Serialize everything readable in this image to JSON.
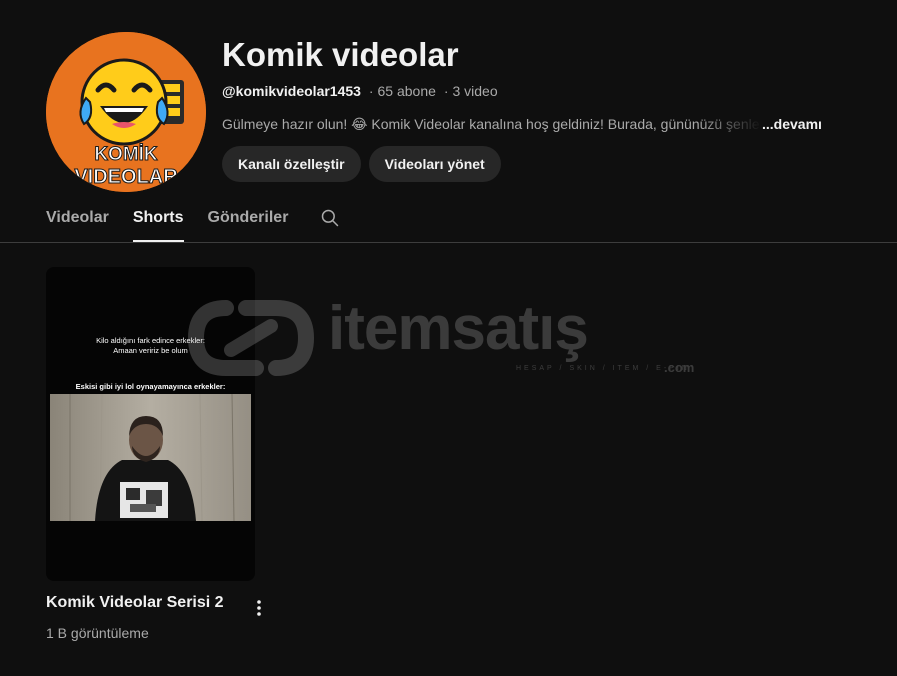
{
  "channel": {
    "name": "Komik videolar",
    "handle": "@komikvideolar1453",
    "subscribers": "65 abone",
    "video_count": "3 video",
    "separator": "·",
    "description": "Gülmeye hazır olun! 😂 Komik Videolar kanalına hoş geldiniz! Burada, gününüzü şenlendirecek",
    "more_label": "...devamı",
    "avatar": {
      "line1": "KOMİK",
      "line2": "VIDEOLAR",
      "bg_color": "#e8731f",
      "emoji_color": "#ffcc1a"
    }
  },
  "buttons": {
    "customize": "Kanalı özelleştir",
    "manage": "Videoları yönet"
  },
  "tabs": [
    {
      "label": "Videolar",
      "active": false
    },
    {
      "label": "Shorts",
      "active": true
    },
    {
      "label": "Gönderiler",
      "active": false
    }
  ],
  "search_icon": "search-icon",
  "shorts": [
    {
      "title": "Komik Videolar Serisi 2",
      "views": "1 B görüntüleme",
      "caption_line1": "Kilo aldığını fark edince erkekler:",
      "caption_line2": "Amaan veririz be olum",
      "caption_line3": "Eskisi gibi iyi lol oynayamayınca erkekler:"
    }
  ],
  "watermark": {
    "word": "itemsatış",
    "tagline": "HESAP / SKIN / ITEM / E-PIN",
    "suffix": ".com"
  },
  "colors": {
    "background": "#0f0f0f",
    "text_primary": "#f1f1f1",
    "text_secondary": "#aaaaaa",
    "button_bg": "#272727"
  }
}
